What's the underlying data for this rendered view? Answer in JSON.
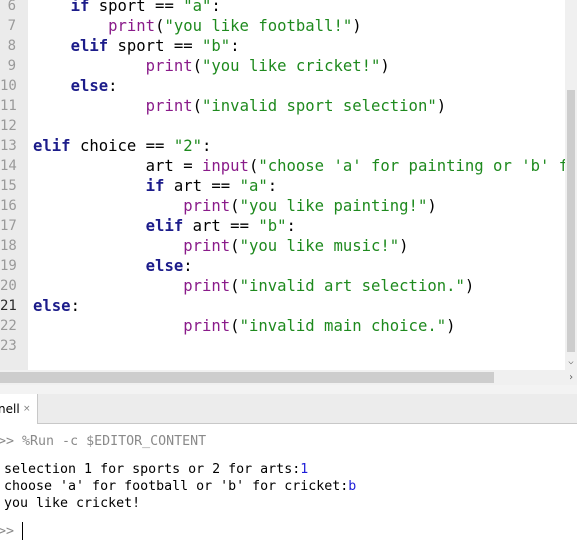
{
  "editor": {
    "line_numbers": [
      "6",
      "7",
      "8",
      "9",
      "10",
      "11",
      "12",
      "13",
      "14",
      "15",
      "16",
      "17",
      "18",
      "19",
      "20",
      "21",
      "22",
      "23"
    ],
    "current_line": "21",
    "lines": [
      [
        {
          "t": "    "
        },
        {
          "t": "if",
          "c": "kw"
        },
        {
          "t": " sport == "
        },
        {
          "t": "\"a\"",
          "c": "str"
        },
        {
          "t": ":"
        }
      ],
      [
        {
          "t": "        "
        },
        {
          "t": "print",
          "c": "bi"
        },
        {
          "t": "("
        },
        {
          "t": "\"you like football!\"",
          "c": "str"
        },
        {
          "t": ")"
        }
      ],
      [
        {
          "t": "    "
        },
        {
          "t": "elif",
          "c": "kw"
        },
        {
          "t": " sport == "
        },
        {
          "t": "\"b\"",
          "c": "str"
        },
        {
          "t": ":"
        }
      ],
      [
        {
          "t": "            "
        },
        {
          "t": "print",
          "c": "bi"
        },
        {
          "t": "("
        },
        {
          "t": "\"you like cricket!\"",
          "c": "str"
        },
        {
          "t": ")"
        }
      ],
      [
        {
          "t": "    "
        },
        {
          "t": "else",
          "c": "kw"
        },
        {
          "t": ":"
        }
      ],
      [
        {
          "t": "            "
        },
        {
          "t": "print",
          "c": "bi"
        },
        {
          "t": "("
        },
        {
          "t": "\"invalid sport selection\"",
          "c": "str"
        },
        {
          "t": ")"
        }
      ],
      [],
      [
        {
          "t": "elif",
          "c": "kw"
        },
        {
          "t": " choice == "
        },
        {
          "t": "\"2\"",
          "c": "str"
        },
        {
          "t": ":"
        }
      ],
      [
        {
          "t": "            art = "
        },
        {
          "t": "input",
          "c": "bi"
        },
        {
          "t": "("
        },
        {
          "t": "\"choose 'a' for painting or 'b' for",
          "c": "str"
        }
      ],
      [
        {
          "t": "            "
        },
        {
          "t": "if",
          "c": "kw"
        },
        {
          "t": " art == "
        },
        {
          "t": "\"a\"",
          "c": "str"
        },
        {
          "t": ":"
        }
      ],
      [
        {
          "t": "                "
        },
        {
          "t": "print",
          "c": "bi"
        },
        {
          "t": "("
        },
        {
          "t": "\"you like painting!\"",
          "c": "str"
        },
        {
          "t": ")"
        }
      ],
      [
        {
          "t": "            "
        },
        {
          "t": "elif",
          "c": "kw"
        },
        {
          "t": " art == "
        },
        {
          "t": "\"b\"",
          "c": "str"
        },
        {
          "t": ":"
        }
      ],
      [
        {
          "t": "                "
        },
        {
          "t": "print",
          "c": "bi"
        },
        {
          "t": "("
        },
        {
          "t": "\"you like music!\"",
          "c": "str"
        },
        {
          "t": ")"
        }
      ],
      [
        {
          "t": "            "
        },
        {
          "t": "else",
          "c": "kw"
        },
        {
          "t": ":"
        }
      ],
      [
        {
          "t": "                "
        },
        {
          "t": "print",
          "c": "bi"
        },
        {
          "t": "("
        },
        {
          "t": "\"invalid art selection.\"",
          "c": "str"
        },
        {
          "t": ")"
        }
      ],
      [
        {
          "t": "else",
          "c": "kw"
        },
        {
          "t": ":"
        }
      ],
      [
        {
          "t": "                "
        },
        {
          "t": "print",
          "c": "bi"
        },
        {
          "t": "("
        },
        {
          "t": "\"invalid main choice.\"",
          "c": "str"
        },
        {
          "t": ")"
        }
      ],
      []
    ]
  },
  "shell_tab": {
    "label": "nell",
    "close_glyph": "×"
  },
  "shell": {
    "prompt": ">>",
    "run_command": "%Run -c $EDITOR_CONTENT",
    "output": [
      {
        "text": "selection 1 for sports or 2 for arts:",
        "input": "1"
      },
      {
        "text": "choose 'a' for football or 'b' for cricket:",
        "input": "b"
      },
      {
        "text": "you like cricket!",
        "input": ""
      }
    ]
  },
  "colors": {
    "keyword": "#1c1c8a",
    "builtin": "#8a1b8a",
    "string": "#1e8a1e",
    "user_input": "#1e1ed8"
  }
}
